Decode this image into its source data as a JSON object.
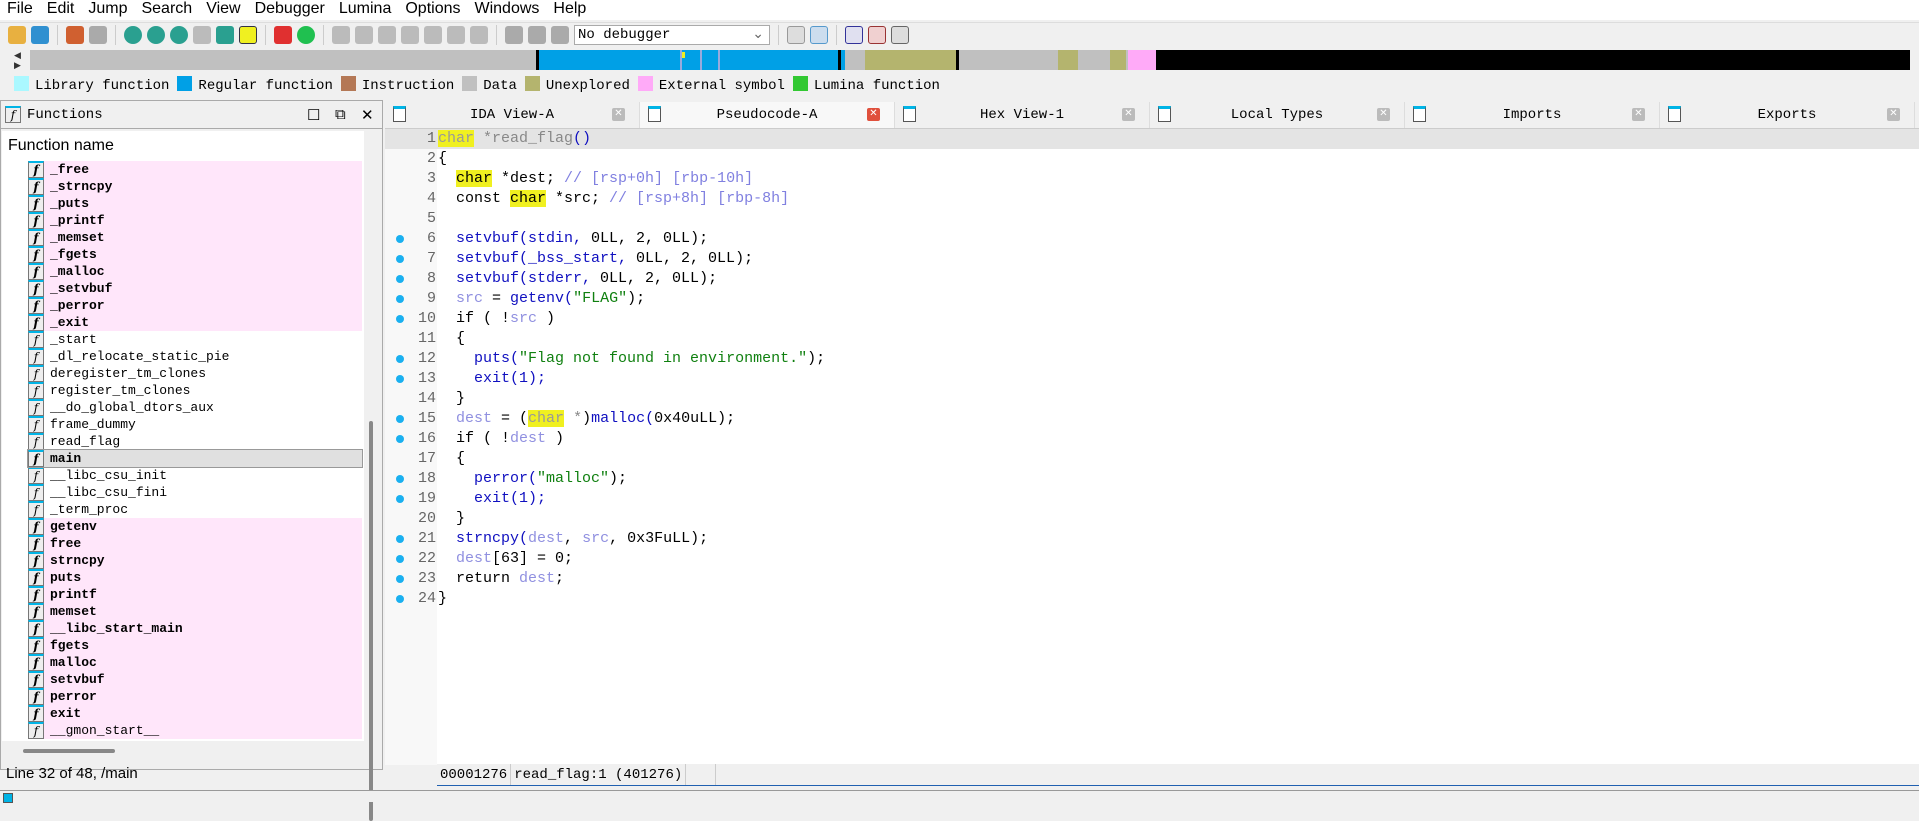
{
  "menu": [
    "File",
    "Edit",
    "Jump",
    "Search",
    "View",
    "Debugger",
    "Lumina",
    "Options",
    "Windows",
    "Help"
  ],
  "toolbar": {
    "debugger_select": "No debugger"
  },
  "legend": [
    {
      "label": "Library function",
      "color": "#aaf8ff"
    },
    {
      "label": "Regular function",
      "color": "#00a0e6"
    },
    {
      "label": "Instruction",
      "color": "#b47856"
    },
    {
      "label": "Data",
      "color": "#c0c0c0"
    },
    {
      "label": "Unexplored",
      "color": "#b4b46e"
    },
    {
      "label": "External symbol",
      "color": "#ffaaf8"
    },
    {
      "label": "Lumina function",
      "color": "#32c832"
    }
  ],
  "functions_panel": {
    "title": "Functions",
    "column_header": "Function name",
    "status": "Line 32 of 48, /main",
    "items": [
      {
        "name": "_free",
        "ext": true,
        "bold": true
      },
      {
        "name": "_strncpy",
        "ext": true,
        "bold": true
      },
      {
        "name": "_puts",
        "ext": true,
        "bold": true
      },
      {
        "name": "_printf",
        "ext": true,
        "bold": true
      },
      {
        "name": "_memset",
        "ext": true,
        "bold": true
      },
      {
        "name": "_fgets",
        "ext": true,
        "bold": true
      },
      {
        "name": "_malloc",
        "ext": true,
        "bold": true
      },
      {
        "name": "_setvbuf",
        "ext": true,
        "bold": true
      },
      {
        "name": "_perror",
        "ext": true,
        "bold": true
      },
      {
        "name": "_exit",
        "ext": true,
        "bold": true
      },
      {
        "name": "_start"
      },
      {
        "name": "_dl_relocate_static_pie"
      },
      {
        "name": "deregister_tm_clones"
      },
      {
        "name": "register_tm_clones"
      },
      {
        "name": "__do_global_dtors_aux"
      },
      {
        "name": "frame_dummy"
      },
      {
        "name": "read_flag"
      },
      {
        "name": "main",
        "bold": true,
        "selected": true
      },
      {
        "name": "__libc_csu_init"
      },
      {
        "name": "__libc_csu_fini"
      },
      {
        "name": "_term_proc"
      },
      {
        "name": "getenv",
        "ext": true,
        "bold": true
      },
      {
        "name": "free",
        "ext": true,
        "bold": true
      },
      {
        "name": "strncpy",
        "ext": true,
        "bold": true
      },
      {
        "name": "puts",
        "ext": true,
        "bold": true
      },
      {
        "name": "printf",
        "ext": true,
        "bold": true
      },
      {
        "name": "memset",
        "ext": true,
        "bold": true
      },
      {
        "name": "__libc_start_main",
        "ext": true,
        "bold": true
      },
      {
        "name": "fgets",
        "ext": true,
        "bold": true
      },
      {
        "name": "malloc",
        "ext": true,
        "bold": true
      },
      {
        "name": "setvbuf",
        "ext": true,
        "bold": true
      },
      {
        "name": "perror",
        "ext": true,
        "bold": true
      },
      {
        "name": "exit",
        "ext": true,
        "bold": true
      },
      {
        "name": "__gmon_start__",
        "ext": true
      }
    ]
  },
  "tabs": [
    {
      "label": "IDA View-A"
    },
    {
      "label": "Pseudocode-A",
      "active": true
    },
    {
      "label": "Hex View-1"
    },
    {
      "label": "Local Types"
    },
    {
      "label": "Imports"
    },
    {
      "label": "Exports"
    }
  ],
  "code": [
    {
      "n": "1",
      "dot": false,
      "seg": [
        [
          "ty",
          "char"
        ],
        [
          "g",
          " *read_flag"
        ],
        [
          "f",
          "()"
        ]
      ]
    },
    {
      "n": "2",
      "dot": false,
      "seg": [
        [
          "k",
          "{"
        ]
      ]
    },
    {
      "n": "3",
      "dot": false,
      "seg": [
        [
          "k",
          "  "
        ],
        [
          "t",
          "char"
        ],
        [
          "k",
          " *dest; "
        ],
        [
          "c",
          "// [rsp+0h] [rbp-10h]"
        ]
      ]
    },
    {
      "n": "4",
      "dot": false,
      "seg": [
        [
          "k",
          "  const "
        ],
        [
          "t",
          "char"
        ],
        [
          "k",
          " *src; "
        ],
        [
          "c",
          "// [rsp+8h] [rbp-8h]"
        ]
      ]
    },
    {
      "n": "5",
      "dot": false,
      "seg": []
    },
    {
      "n": "6",
      "dot": true,
      "seg": [
        [
          "k",
          "  "
        ],
        [
          "f",
          "setvbuf(stdin, "
        ],
        [
          "k",
          "0LL, 2, 0LL);"
        ]
      ]
    },
    {
      "n": "7",
      "dot": true,
      "seg": [
        [
          "k",
          "  "
        ],
        [
          "f",
          "setvbuf(_bss_start, "
        ],
        [
          "k",
          "0LL, 2, 0LL);"
        ]
      ]
    },
    {
      "n": "8",
      "dot": true,
      "seg": [
        [
          "k",
          "  "
        ],
        [
          "f",
          "setvbuf(stderr, "
        ],
        [
          "k",
          "0LL, 2, 0LL);"
        ]
      ]
    },
    {
      "n": "9",
      "dot": true,
      "seg": [
        [
          "k",
          "  "
        ],
        [
          "v",
          "src"
        ],
        [
          "k",
          " = "
        ],
        [
          "f",
          "getenv("
        ],
        [
          "s",
          "\"FLAG\""
        ],
        [
          "k",
          ");"
        ]
      ]
    },
    {
      "n": "10",
      "dot": true,
      "seg": [
        [
          "k",
          "  if ( !"
        ],
        [
          "v",
          "src"
        ],
        [
          "k",
          " )"
        ]
      ]
    },
    {
      "n": "11",
      "dot": false,
      "seg": [
        [
          "k",
          "  {"
        ]
      ]
    },
    {
      "n": "12",
      "dot": true,
      "seg": [
        [
          "k",
          "    "
        ],
        [
          "f",
          "puts("
        ],
        [
          "s",
          "\"Flag not found in environment.\""
        ],
        [
          "k",
          ");"
        ]
      ]
    },
    {
      "n": "13",
      "dot": true,
      "seg": [
        [
          "k",
          "    "
        ],
        [
          "f",
          "exit(1);"
        ]
      ]
    },
    {
      "n": "14",
      "dot": false,
      "seg": [
        [
          "k",
          "  }"
        ]
      ]
    },
    {
      "n": "15",
      "dot": true,
      "seg": [
        [
          "k",
          "  "
        ],
        [
          "v",
          "dest"
        ],
        [
          "k",
          " = ("
        ],
        [
          "ty",
          "char"
        ],
        [
          "g",
          " *"
        ],
        [
          "k",
          ")"
        ],
        [
          "f",
          "malloc("
        ],
        [
          "k",
          "0x40uLL);"
        ]
      ]
    },
    {
      "n": "16",
      "dot": true,
      "seg": [
        [
          "k",
          "  if ( !"
        ],
        [
          "v",
          "dest"
        ],
        [
          "k",
          " )"
        ]
      ]
    },
    {
      "n": "17",
      "dot": false,
      "seg": [
        [
          "k",
          "  {"
        ]
      ]
    },
    {
      "n": "18",
      "dot": true,
      "seg": [
        [
          "k",
          "    "
        ],
        [
          "f",
          "perror("
        ],
        [
          "s",
          "\"malloc\""
        ],
        [
          "k",
          ");"
        ]
      ]
    },
    {
      "n": "19",
      "dot": true,
      "seg": [
        [
          "k",
          "    "
        ],
        [
          "f",
          "exit(1);"
        ]
      ]
    },
    {
      "n": "20",
      "dot": false,
      "seg": [
        [
          "k",
          "  }"
        ]
      ]
    },
    {
      "n": "21",
      "dot": true,
      "seg": [
        [
          "k",
          "  "
        ],
        [
          "f",
          "strncpy("
        ],
        [
          "v",
          "dest"
        ],
        [
          "k",
          ", "
        ],
        [
          "v",
          "src"
        ],
        [
          "k",
          ", 0x3FuLL);"
        ]
      ]
    },
    {
      "n": "22",
      "dot": true,
      "seg": [
        [
          "k",
          "  "
        ],
        [
          "v",
          "dest"
        ],
        [
          "k",
          "[63] = 0;"
        ]
      ]
    },
    {
      "n": "23",
      "dot": true,
      "seg": [
        [
          "k",
          "  return "
        ],
        [
          "v",
          "dest"
        ],
        [
          "k",
          ";"
        ]
      ]
    },
    {
      "n": "24",
      "dot": true,
      "seg": [
        [
          "k",
          "}"
        ]
      ]
    }
  ],
  "code_status": {
    "offset": "00001276",
    "location": "read_flag:1 (401276)"
  }
}
